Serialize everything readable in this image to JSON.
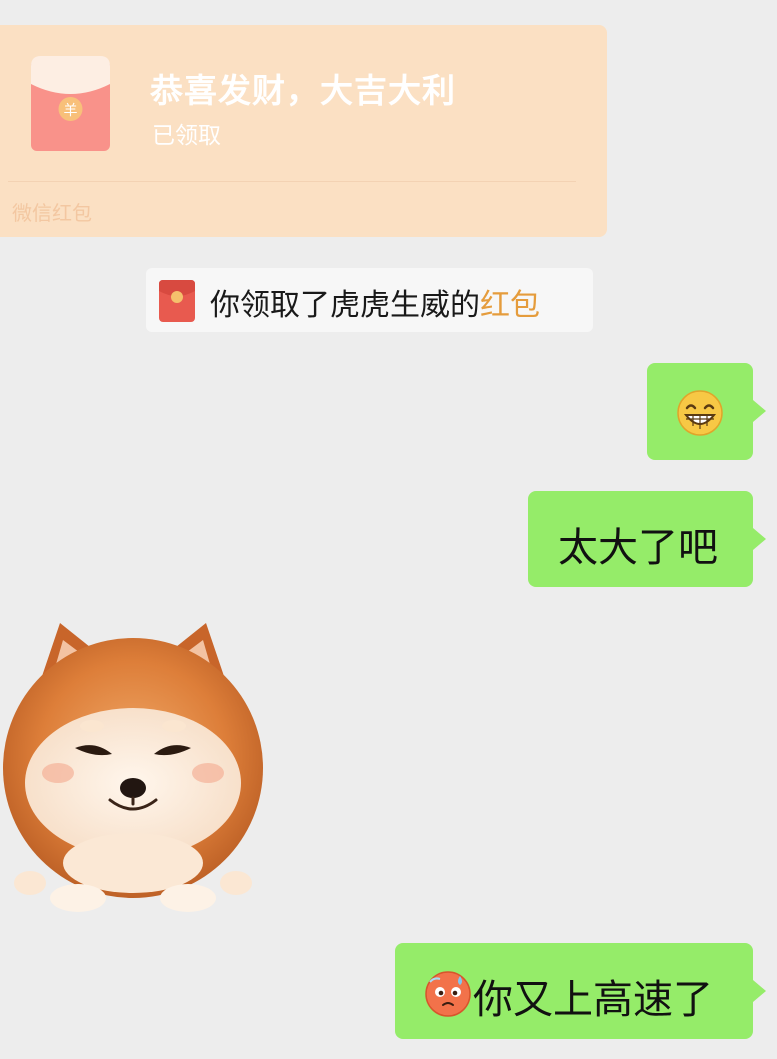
{
  "red_packet": {
    "title": "恭喜发财，大吉大利",
    "status": "已领取",
    "footer": "微信红包",
    "coin_symbol": "羊",
    "accent_color": "#fbe0c3"
  },
  "notice": {
    "text_prefix": "你领取了虎虎生威的",
    "link_text": "红包",
    "link_color": "#e59c3c"
  },
  "messages": [
    {
      "side": "right",
      "icon": "grinning-face-icon"
    },
    {
      "side": "right",
      "text": "太大了吧"
    },
    {
      "side": "left",
      "icon": "shiba-dog-sticker"
    },
    {
      "side": "right",
      "text": "你又上高速了",
      "icon": "sweating-face-icon"
    }
  ],
  "bubble_color": "#95ec69",
  "background_color": "#ededed"
}
